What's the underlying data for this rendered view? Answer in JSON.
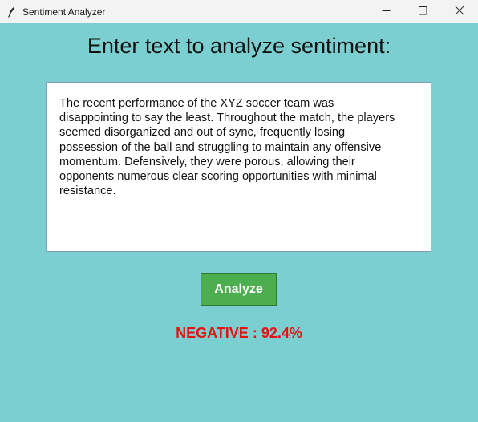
{
  "window": {
    "title": "Sentiment Analyzer",
    "background_color": "#7ccfd0",
    "icons": {
      "app": "feather-icon",
      "minimize": "minimize-icon",
      "maximize": "maximize-icon",
      "close": "close-icon"
    }
  },
  "main": {
    "heading": "Enter text to analyze sentiment:",
    "input_text": "The recent performance of the XYZ soccer team was\ndisappointing to say the least. Throughout the match, the players\nseemed disorganized and out of sync, frequently losing\npossession of the ball and struggling to maintain any offensive\nmomentum. Defensively, they were porous, allowing their\nopponents numerous clear scoring opportunities with minimal\nresistance.",
    "analyze_label": "Analyze",
    "analyze_color": "#4cae4f",
    "result_text": "NEGATIVE : 92.4%",
    "result_color": "#e3140f"
  }
}
